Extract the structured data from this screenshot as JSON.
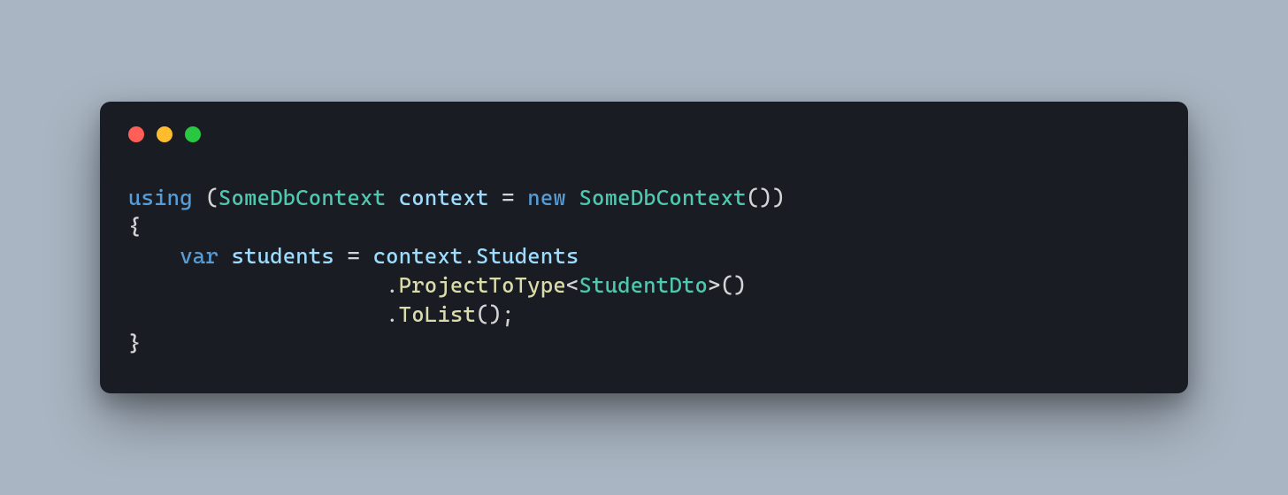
{
  "code": {
    "line1": {
      "using": "using",
      "paren_open": " (",
      "type1": "SomeDbContext",
      "space1": " ",
      "var1": "context",
      "equals": " = ",
      "new": "new",
      "space2": " ",
      "type2": "SomeDbContext",
      "parens": "())"
    },
    "line2": {
      "brace": "{"
    },
    "line3": {
      "indent": "    ",
      "var_kw": "var",
      "space1": " ",
      "var_name": "students",
      "equals": " = ",
      "ctx": "context",
      "dot": ".",
      "prop": "Students"
    },
    "line4": {
      "indent": "                    .",
      "method": "ProjectToType",
      "lt": "<",
      "generic": "StudentDto",
      "gt": ">",
      "parens": "()"
    },
    "line5": {
      "indent": "                    .",
      "method": "ToList",
      "parens": "();"
    },
    "line6": {
      "brace": "}"
    }
  },
  "colors": {
    "background": "#a9b5c2",
    "window_bg": "#191d23",
    "traffic_red": "#ff5f57",
    "traffic_yellow": "#febc2e",
    "traffic_green": "#28c840",
    "keyword": "#569cd6",
    "type": "#4ec9b0",
    "identifier": "#9cdcfe",
    "method": "#dcdcaa",
    "punctuation": "#d4d4d4"
  }
}
